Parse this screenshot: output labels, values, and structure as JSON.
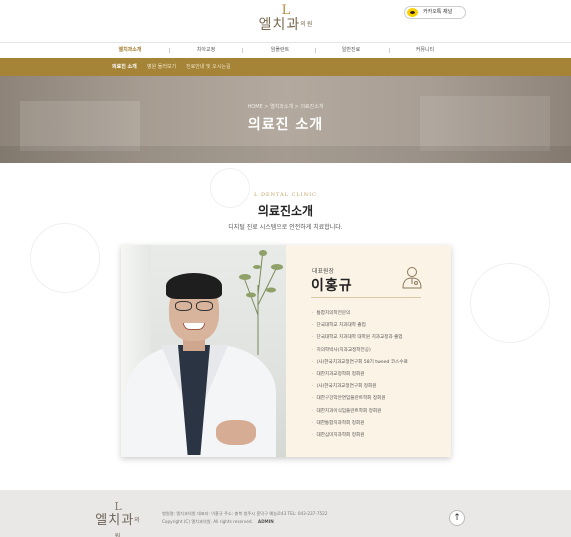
{
  "header": {
    "logo_mark": "L",
    "logo_text": "엘치과",
    "logo_suffix": "의원",
    "kakao_label": "카카오톡 채널"
  },
  "gnb": {
    "items": [
      "엘치과소개",
      "치아교정",
      "임플란트",
      "일반진료",
      "커뮤니티"
    ],
    "active_index": 0
  },
  "subnav": {
    "items": [
      "의료진 소개",
      "병원 둘러보기",
      "진료안내 및 오시는길"
    ],
    "active_index": 0
  },
  "hero": {
    "breadcrumb": "HOME > 엘치과소개 > 의료진소개",
    "title": "의료진 소개"
  },
  "section": {
    "eyebrow": "L DENTAL CLINIC",
    "title": "의료진소개",
    "subtitle": "디지털 진료 시스템으로 안전하게 치료합니다."
  },
  "doctor": {
    "role": "대표원장",
    "name": "이홍규",
    "career": [
      "통합치의학전문의",
      "단국대학교 치과대학 졸업",
      "단국대학교 치과대학 대학원 치과교정과 졸업",
      "치의학박사(치과교정학전공)",
      "(사)한국치과교정연구회 58기 tweed 코스수료",
      "대한치과교정학회 정회원",
      "(사)한국치과교정연구회 정회원",
      "대한구강악안면임플란트학회 정회원",
      "대한치과이식임플란트학회 정회원",
      "대한통합치과학회 정회원",
      "대한심미치과학회 정회원"
    ]
  },
  "footer": {
    "line1": "병원명: 엘치과의원   대표자: 이홍규   주소: 충북 청주시 흥덕구 예농로43   TEL: 043-237-7522",
    "line2": "Copyright (C) 엘치과의원. All rights reserved.",
    "admin": "ADMIN",
    "top_button": "↑"
  }
}
